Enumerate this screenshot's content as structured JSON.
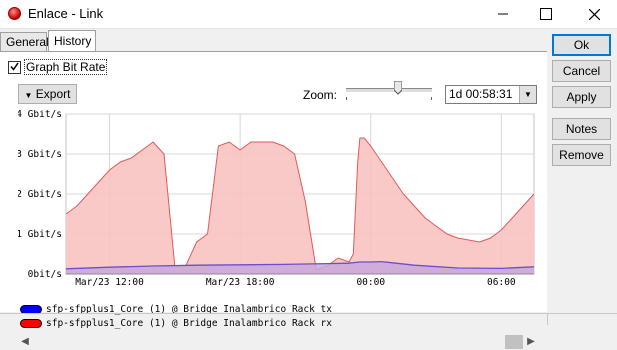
{
  "window": {
    "title": "Enlace - Link"
  },
  "tabs": [
    {
      "label": "General"
    },
    {
      "label": "History"
    }
  ],
  "history": {
    "graph_bit_rate_label": "Graph Bit Rate",
    "graph_bit_rate_checked": true,
    "export_label": "Export",
    "zoom_label": "Zoom:",
    "zoom_value": "1d 00:58:31",
    "zoom_slider_fraction": 0.6
  },
  "buttons": {
    "ok": "Ok",
    "cancel": "Cancel",
    "apply": "Apply",
    "notes": "Notes",
    "remove": "Remove"
  },
  "colors": {
    "rx_fill": "#f7c3c0",
    "rx_line": "#e05a5a",
    "tx_fill": "#c9a8dc",
    "tx_line": "#6a4fd0",
    "tx_swatch": "#0000ff",
    "rx_swatch": "#ff0000"
  },
  "chart_data": {
    "type": "area",
    "yticks": [
      "4 Gbit/s",
      "3 Gbit/s",
      "2 Gbit/s",
      "1 Gbit/s",
      "0bit/s"
    ],
    "ylim": [
      0,
      4
    ],
    "xlim": [
      0,
      21.5
    ],
    "xticks": [
      {
        "label": "Mar/23 12:00",
        "x": 2
      },
      {
        "label": "Mar/23 18:00",
        "x": 8
      },
      {
        "label": "00:00",
        "x": 14
      },
      {
        "label": "06:00",
        "x": 20
      }
    ],
    "grid": true,
    "legend_position": "bottom",
    "series": [
      {
        "name": "sfp-sfpplus1_Core (1) @ Bridge Inalambrico Rack tx",
        "x": [
          0,
          2,
          4,
          6,
          8,
          10,
          12,
          13,
          13.5,
          14,
          14.5,
          15,
          16,
          18,
          20,
          21.5
        ],
        "y": [
          0.13,
          0.17,
          0.2,
          0.22,
          0.23,
          0.24,
          0.26,
          0.27,
          0.3,
          0.3,
          0.31,
          0.28,
          0.22,
          0.15,
          0.14,
          0.18
        ]
      },
      {
        "name": "sfp-sfpplus1_Core (1) @ Bridge Inalambrico Rack rx",
        "x": [
          0,
          0.5,
          1,
          1.5,
          2,
          2.5,
          3,
          3.5,
          4,
          4.5,
          5,
          5.5,
          6,
          6.5,
          7,
          7.5,
          8,
          8.5,
          9,
          9.5,
          10,
          10.5,
          11,
          11.5,
          12,
          12.5,
          13,
          13.2,
          13.4,
          13.5,
          13.7,
          14,
          14.5,
          15,
          15.5,
          16,
          16.5,
          17,
          17.5,
          18,
          18.5,
          19,
          19.5,
          20,
          20.5,
          21,
          21.5
        ],
        "y": [
          1.5,
          1.7,
          2.0,
          2.3,
          2.6,
          2.8,
          2.9,
          3.1,
          3.3,
          3.0,
          0.2,
          0.2,
          0.8,
          1.0,
          3.2,
          3.3,
          3.1,
          3.3,
          3.3,
          3.3,
          3.2,
          3.0,
          1.8,
          0.1,
          0.2,
          0.4,
          0.3,
          0.5,
          2.8,
          3.4,
          3.4,
          3.2,
          2.8,
          2.4,
          2.0,
          1.7,
          1.4,
          1.2,
          1.0,
          0.9,
          0.85,
          0.8,
          0.9,
          1.1,
          1.4,
          1.7,
          2.0
        ]
      }
    ]
  }
}
